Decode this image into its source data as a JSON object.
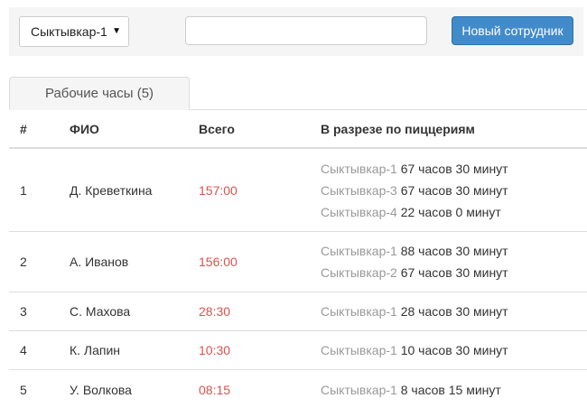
{
  "toolbar": {
    "city_select": "Сыктывкар-1",
    "search_value": "",
    "search_placeholder": "",
    "new_employee_label": "Новый сотрудник"
  },
  "tabs": [
    {
      "label": "Рабочие часы (5)",
      "active": true
    }
  ],
  "table": {
    "headers": {
      "num": "#",
      "name": "ФИО",
      "total": "Всего",
      "split": "В разрезе по пиццериям"
    },
    "rows": [
      {
        "num": "1",
        "name": "Д. Креветкина",
        "total": "157:00",
        "split": [
          {
            "pizzeria": "Сыктывкар-1",
            "hours": "67 часов 30 минут"
          },
          {
            "pizzeria": "Сыктывкар-3",
            "hours": "67 часов 30 минут"
          },
          {
            "pizzeria": "Сыктывкар-4",
            "hours": "22 часов 0 минут"
          }
        ]
      },
      {
        "num": "2",
        "name": "А. Иванов",
        "total": "156:00",
        "split": [
          {
            "pizzeria": "Сыктывкар-1",
            "hours": "88 часов 30 минут"
          },
          {
            "pizzeria": "Сыктывкар-2",
            "hours": "67 часов 30 минут"
          }
        ]
      },
      {
        "num": "3",
        "name": "С. Махова",
        "total": "28:30",
        "split": [
          {
            "pizzeria": "Сыктывкар-1",
            "hours": "28 часов 30 минут"
          }
        ]
      },
      {
        "num": "4",
        "name": "К. Лапин",
        "total": "10:30",
        "split": [
          {
            "pizzeria": "Сыктывкар-1",
            "hours": "10 часов 30 минут"
          }
        ]
      },
      {
        "num": "5",
        "name": "У. Волкова",
        "total": "08:15",
        "split": [
          {
            "pizzeria": "Сыктывкар-1",
            "hours": "8 часов 15 минут"
          }
        ]
      }
    ]
  },
  "colors": {
    "primary": "#428bca",
    "total_text": "#d9534f",
    "pizzeria_text": "#999999"
  }
}
